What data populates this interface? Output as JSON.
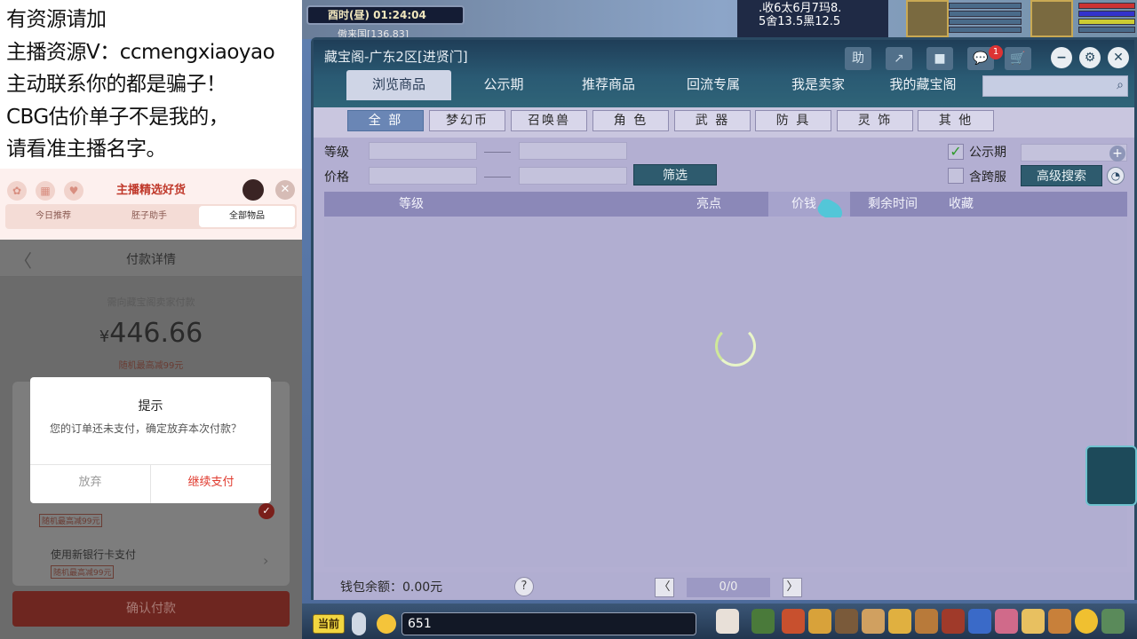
{
  "notice": {
    "lines": [
      "有资源请加",
      "主播资源V：ccmengxiaoyao",
      "主动联系你的都是骗子！",
      "CBG估价单子不是我的，",
      "请看准主播名字。"
    ]
  },
  "shop": {
    "title": "主播精选好货",
    "tabs": [
      "今日推荐",
      "胚子助手",
      "全部物品"
    ],
    "close": "✕"
  },
  "payment": {
    "back": "〈",
    "title": "付款详情",
    "subtitle": "需向藏宝阁卖家付款",
    "currency": "¥",
    "amount": "446.66",
    "random_discount": "随机最高减99元",
    "method_bank_tag": "随机最高减99元",
    "method_new_card": "使用新银行卡支付",
    "method_new_card_tag": "随机最高减99元",
    "confirm": "确认付款"
  },
  "dialog": {
    "title": "提示",
    "message": "您的订单还未支付，确定放弃本次付款？",
    "abandon": "放弃",
    "continue": "继续支付"
  },
  "game": {
    "time": "酉时(昼)  01:24:04",
    "location": "傲来国[136,83]",
    "info_lines": [
      ".收6太6月7玛8.",
      "5舍13.5黑12.5"
    ],
    "chat_value": "651",
    "current_channel": "当前"
  },
  "window": {
    "title": "藏宝阁-广东2区[进贤门]",
    "title_buttons": [
      "助",
      "↗",
      "■",
      "💬",
      "🛒"
    ],
    "msg_count": "1",
    "main_tabs": [
      "浏览商品",
      "公示期",
      "推荐商品",
      "回流专属",
      "我是卖家",
      "我的藏宝阁"
    ],
    "categories": [
      "全 部",
      "梦幻币",
      "召唤兽",
      "角 色",
      "武 器",
      "防 具",
      "灵 饰",
      "其 他"
    ],
    "filter": {
      "level_label": "等级",
      "price_label": "价格",
      "filter_button": "筛选",
      "gongshi_label": "公示期",
      "cross_server_label": "含跨服",
      "advanced_search": "高级搜索"
    },
    "columns": [
      "等级",
      "亮点",
      "价钱",
      "剩余时间",
      "收藏"
    ],
    "wallet": "钱包余额：0.00元",
    "pagination": "0/0",
    "prev": "〈",
    "next": "〉",
    "help": "?"
  }
}
